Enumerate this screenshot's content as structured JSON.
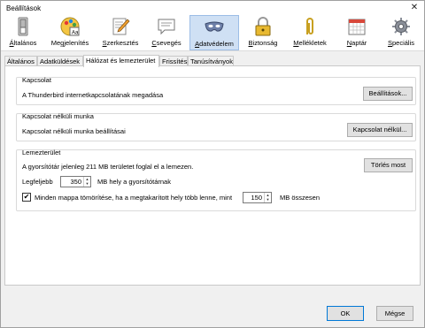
{
  "window": {
    "title": "Beállítások",
    "close_label": "✕"
  },
  "toolbar": {
    "panes": [
      {
        "label_pre": "",
        "label_key": "Á",
        "label_post": "ltalános",
        "icon": "switch-icon"
      },
      {
        "label_pre": "Me",
        "label_key": "g",
        "label_post": "jelenítés",
        "icon": "palette-icon"
      },
      {
        "label_pre": "",
        "label_key": "S",
        "label_post": "zerkesztés",
        "icon": "pen-icon"
      },
      {
        "label_pre": "",
        "label_key": "C",
        "label_post": "sevegés",
        "icon": "chat-icon"
      },
      {
        "label_pre": "",
        "label_key": "A",
        "label_post": "datvédelem",
        "icon": "mask-icon"
      },
      {
        "label_pre": "",
        "label_key": "B",
        "label_post": "iztonság",
        "icon": "lock-icon"
      },
      {
        "label_pre": "",
        "label_key": "M",
        "label_post": "ellékletek",
        "icon": "paperclip-icon"
      },
      {
        "label_pre": "",
        "label_key": "N",
        "label_post": "aptár",
        "icon": "calendar-icon"
      },
      {
        "label_pre": "",
        "label_key": "S",
        "label_post": "peciális",
        "icon": "gear-icon"
      }
    ]
  },
  "tabs": [
    "Általános",
    "Adatküldések",
    "Hálózat és lemezterület",
    "Frissítés",
    "Tanúsítványok"
  ],
  "connection": {
    "title": "Kapcsolat",
    "description": "A Thunderbird internetkapcsolatának megadása",
    "button": "Beállítások..."
  },
  "offline": {
    "title": "Kapcsolat nélküli munka",
    "description": "Kapcsolat nélküli munka beállításai",
    "button": "Kapcsolat nélkül..."
  },
  "disk": {
    "title": "Lemezterület",
    "usage_text": "A gyorsítótár jelenleg 211 MB területet foglal el a lemezen.",
    "clear_button": "Törlés most",
    "max_label": "Legfeljebb",
    "max_value": "350",
    "max_suffix": "MB hely a gyorsítótárnak",
    "compact_label": "Minden mappa tömörítése, ha a megtakarított hely több lenne, mint",
    "compact_value": "150",
    "compact_suffix": "MB összesen",
    "compact_checked": "✔"
  },
  "footer": {
    "ok": "OK",
    "cancel": "Mégse"
  }
}
